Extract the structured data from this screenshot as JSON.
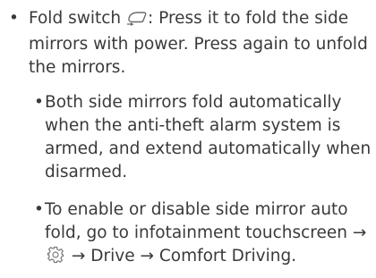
{
  "items": [
    {
      "bullet": "•",
      "lead": "Fold switch",
      "icon": "mirror-fold-icon",
      "rest": ": Press it to fold the side mirrors with power. Press again to unfold the mirrors."
    }
  ],
  "subitems": [
    {
      "bullet": "•",
      "text": "Both side mirrors fold automatically when the anti-theft alarm system is armed, and extend automatically when disarmed."
    },
    {
      "bullet": "•",
      "text_before": "To enable or disable side mirror auto fold, go to infotainment touchscreen → ",
      "icon": "gear-icon",
      "text_after": " → Drive → Comfort Driving."
    }
  ]
}
